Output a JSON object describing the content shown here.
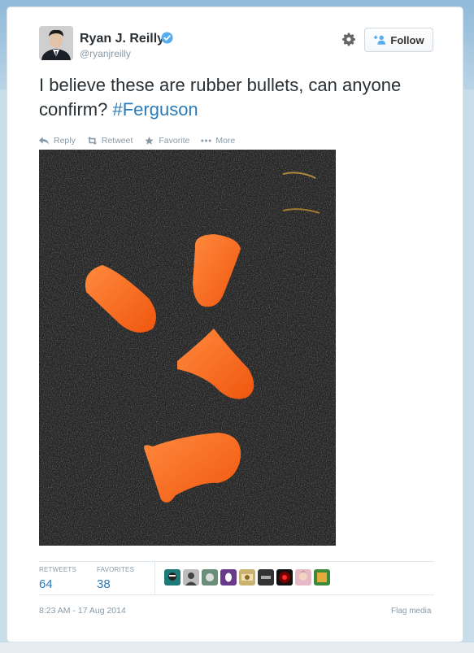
{
  "user": {
    "name": "Ryan J. Reilly",
    "handle": "@ryanjreilly",
    "verified": true
  },
  "follow_button": {
    "label": "Follow",
    "icon": "add-user-icon"
  },
  "tweet": {
    "text": "I believe these are rubber bullets, can anyone confirm?",
    "hashtag": "#Ferguson"
  },
  "actions": [
    {
      "label": "Reply",
      "icon": "reply-icon"
    },
    {
      "label": "Retweet",
      "icon": "retweet-icon"
    },
    {
      "label": "Favorite",
      "icon": "star-icon"
    },
    {
      "label": "More",
      "icon": "more-dots-icon"
    }
  ],
  "stats": {
    "retweets_label": "RETWEETS",
    "retweets_count": "64",
    "favorites_label": "FAVORITES",
    "favorites_count": "38"
  },
  "timestamp": "8:23 AM - 17 Aug 2014",
  "flag_media": "Flag media",
  "colors": {
    "link": "#2b7bb9",
    "muted": "#8899a6",
    "text": "#292f33",
    "verified": "#55acee",
    "orange": "#ff6a1a"
  }
}
